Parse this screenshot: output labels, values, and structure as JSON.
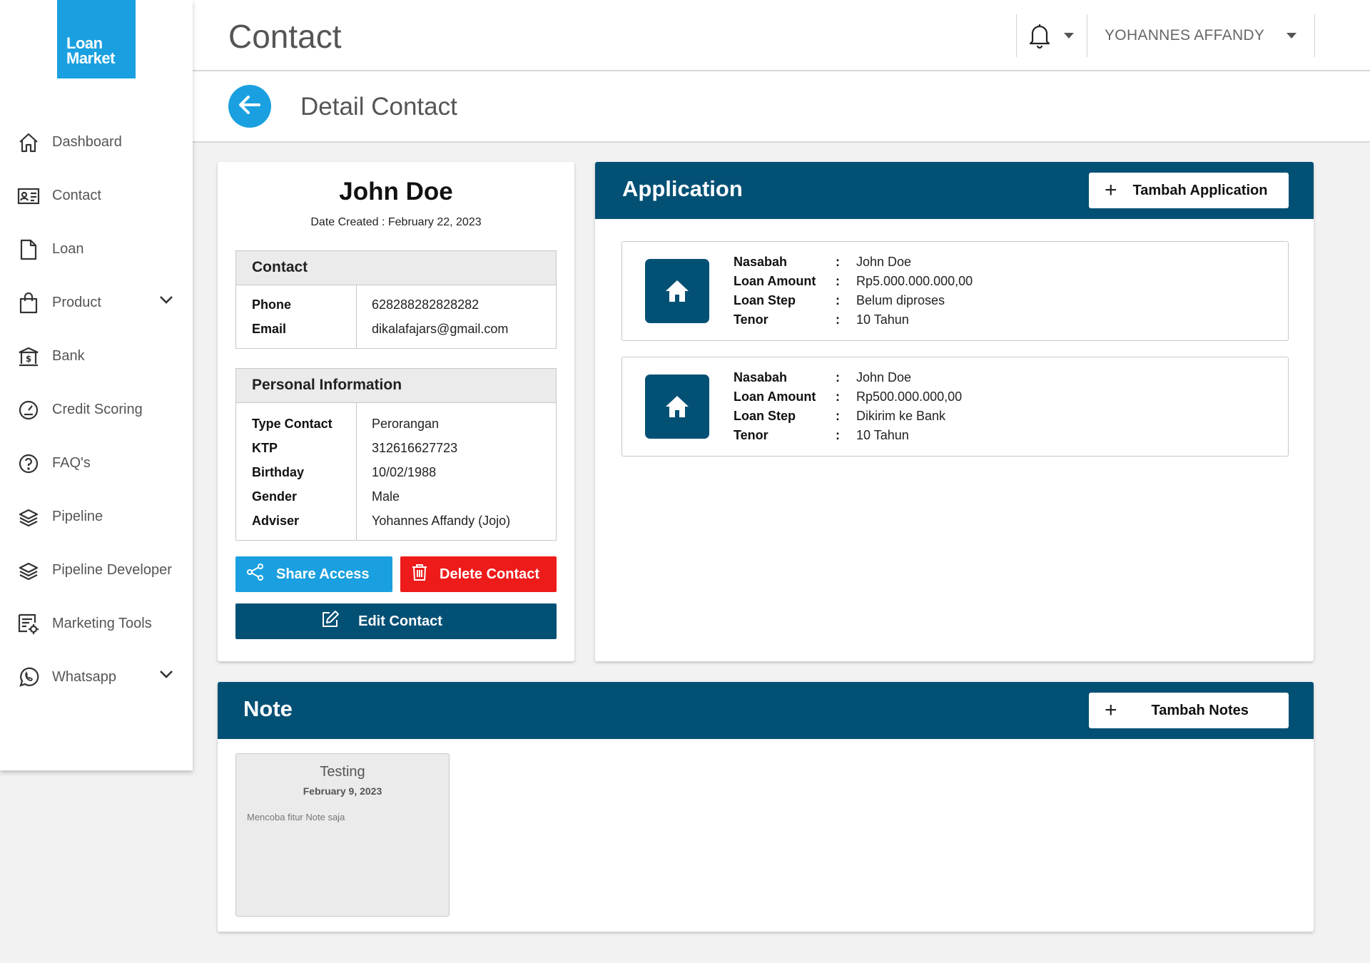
{
  "brand": {
    "line1": "Loan",
    "line2": "Market",
    "color": "#1aa0e0"
  },
  "sidebar": {
    "items": [
      {
        "label": "Dashboard",
        "icon": "home-icon"
      },
      {
        "label": "Contact",
        "icon": "contact-card-icon"
      },
      {
        "label": "Loan",
        "icon": "document-icon"
      },
      {
        "label": "Product",
        "icon": "shopping-bag-icon",
        "expandable": true
      },
      {
        "label": "Bank",
        "icon": "bank-icon"
      },
      {
        "label": "Credit Scoring",
        "icon": "gauge-icon"
      },
      {
        "label": "FAQ's",
        "icon": "question-icon"
      },
      {
        "label": "Pipeline",
        "icon": "layers-icon"
      },
      {
        "label": "Pipeline Developer",
        "icon": "layers-icon"
      },
      {
        "label": "Marketing Tools",
        "icon": "settings-list-icon"
      },
      {
        "label": "Whatsapp",
        "icon": "whatsapp-icon",
        "expandable": true
      }
    ]
  },
  "header": {
    "title": "Contact",
    "user_name": "YOHANNES AFFANDY"
  },
  "subheader": {
    "title": "Detail Contact"
  },
  "contact": {
    "name": "John Doe",
    "date_created": "Date Created : February 22, 2023",
    "contact_section": {
      "title": "Contact",
      "rows": [
        {
          "key": "Phone",
          "value": "628288282828282"
        },
        {
          "key": "Email",
          "value": "dikalafajars@gmail.com"
        }
      ]
    },
    "personal_section": {
      "title": "Personal Information",
      "rows": [
        {
          "key": "Type Contact",
          "value": "Perorangan"
        },
        {
          "key": "KTP",
          "value": "312616627723"
        },
        {
          "key": "Birthday",
          "value": "10/02/1988"
        },
        {
          "key": "Gender",
          "value": "Male"
        },
        {
          "key": "Adviser",
          "value": "Yohannes Affandy (Jojo)"
        }
      ]
    },
    "buttons": {
      "share": "Share Access",
      "delete": "Delete Contact",
      "edit": "Edit Contact"
    }
  },
  "application": {
    "title": "Application",
    "add_button": "Tambah Application",
    "labels": {
      "nasabah": "Nasabah",
      "loan_amount": "Loan Amount",
      "loan_step": "Loan Step",
      "tenor": "Tenor",
      "colon": ":"
    },
    "items": [
      {
        "nasabah": "John Doe",
        "loan_amount": "Rp5.000.000.000,00",
        "loan_step": "Belum diproses",
        "tenor": "10 Tahun"
      },
      {
        "nasabah": "John Doe",
        "loan_amount": "Rp500.000.000,00",
        "loan_step": "Dikirim ke Bank",
        "tenor": "10 Tahun"
      }
    ]
  },
  "note": {
    "title": "Note",
    "add_button": "Tambah Notes",
    "items": [
      {
        "title": "Testing",
        "date": "February 9, 2023",
        "text": "Mencoba fitur Note saja"
      }
    ]
  },
  "colors": {
    "primary_dark": "#035075",
    "accent_blue": "#1aa0e0",
    "danger": "#ee1b1b"
  }
}
